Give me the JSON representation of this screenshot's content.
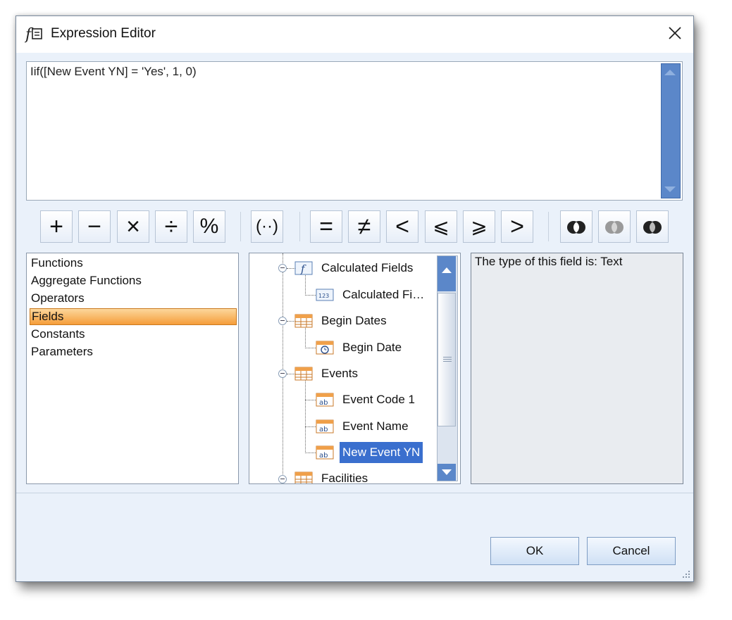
{
  "window": {
    "title": "Expression Editor",
    "close_glyph": "✕"
  },
  "expression": {
    "value": "Iif([New Event YN] = 'Yes', 1, 0)"
  },
  "toolbar": {
    "arithmetic": [
      "+",
      "−",
      "×",
      "÷",
      "%"
    ],
    "group": "(··)",
    "comparison": [
      "=",
      "≠",
      "<",
      "⩽",
      "⩾",
      ">"
    ],
    "logical_icons": [
      "logical-and-icon",
      "logical-or-icon",
      "logical-not-icon"
    ]
  },
  "categories": {
    "items": [
      "Functions",
      "Aggregate Functions",
      "Operators",
      "Fields",
      "Constants",
      "Parameters"
    ],
    "selected": "Fields"
  },
  "tree": {
    "nodes": [
      {
        "label": "Calculated Fields",
        "icon": "function-icon"
      },
      {
        "label": "Calculated Fi…",
        "icon": "number-field-icon"
      },
      {
        "label": "Begin Dates",
        "icon": "table-icon"
      },
      {
        "label": "Begin Date",
        "icon": "date-field-icon"
      },
      {
        "label": "Events",
        "icon": "table-icon"
      },
      {
        "label": "Event Code 1",
        "icon": "text-field-icon"
      },
      {
        "label": "Event Name",
        "icon": "text-field-icon"
      },
      {
        "label": "New Event YN",
        "icon": "text-field-icon"
      },
      {
        "label": "Facilities",
        "icon": "table-icon"
      }
    ],
    "selected": "New Event YN",
    "icon_text": {
      "number": "123",
      "text": "ab",
      "function": "f"
    }
  },
  "description": {
    "text": "The type of this field is: Text"
  },
  "buttons": {
    "ok": "OK",
    "cancel": "Cancel"
  },
  "colors": {
    "selection_orange": "#f59d3a",
    "selection_blue": "#3a6fce",
    "scrollbar_blue": "#5b87c9"
  }
}
